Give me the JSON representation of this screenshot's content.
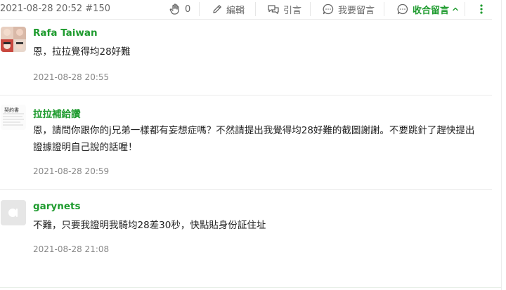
{
  "post": {
    "meta": "2021-08-28 20:52 #150",
    "like_count": "0",
    "edit_label": "編輯",
    "quote_label": "引言",
    "reply_label": "我要留言",
    "collapse_label": "收合留言",
    "collapse_arrow": "^"
  },
  "colors": {
    "accent": "#1e9b2e",
    "muted": "#888888"
  },
  "comments": [
    {
      "username": "Rafa Taiwan",
      "content": "恩，拉拉覺得均28好難",
      "timestamp": "2021-08-28 20:55"
    },
    {
      "username": "拉拉補給讚",
      "content": "恩，請問你跟你的j兄弟一樣都有妄想症嗎？不然請提出我覺得均28好難的截圖謝謝。不要跳針了趕快提出證據證明自己說的話喔！",
      "avatar_text": "契約書",
      "timestamp": "2021-08-28 20:59"
    },
    {
      "username": "garynets",
      "content": "不難，只要我證明我騎均28差30秒，快點貼身份証住址",
      "timestamp": "2021-08-28 21:08"
    }
  ]
}
